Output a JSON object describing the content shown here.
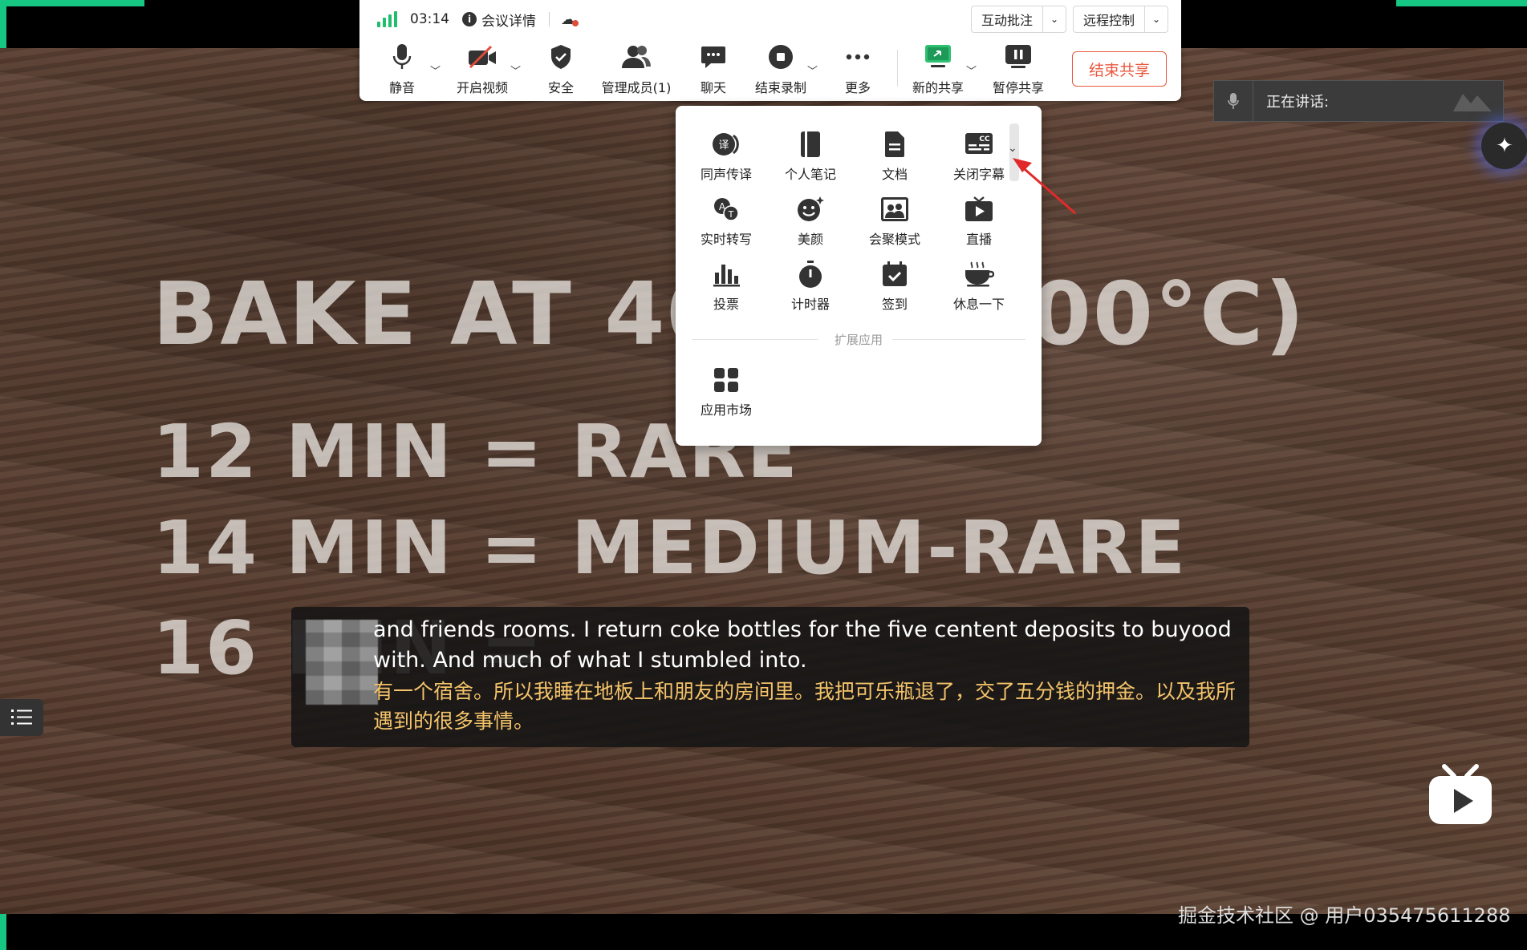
{
  "status_bar": {
    "timer": "03:14",
    "meeting_details": "会议详情",
    "interactive_annotation": "互动批注",
    "remote_control": "远程控制"
  },
  "toolbar": {
    "mute": "静音",
    "start_video": "开启视频",
    "security": "安全",
    "manage_members": "管理成员(1)",
    "chat": "聊天",
    "end_recording": "结束录制",
    "more": "更多",
    "new_share": "新的共享",
    "pause_share": "暂停共享",
    "end_share": "结束共享"
  },
  "more_menu": {
    "items": [
      {
        "label": "同声传译",
        "icon": "interpretation-icon"
      },
      {
        "label": "个人笔记",
        "icon": "notebook-icon"
      },
      {
        "label": "文档",
        "icon": "document-icon"
      },
      {
        "label": "关闭字幕",
        "icon": "captions-icon"
      },
      {
        "label": "实时转写",
        "icon": "transcription-icon"
      },
      {
        "label": "美颜",
        "icon": "beauty-icon"
      },
      {
        "label": "会聚模式",
        "icon": "together-mode-icon"
      },
      {
        "label": "直播",
        "icon": "live-icon"
      },
      {
        "label": "投票",
        "icon": "poll-icon"
      },
      {
        "label": "计时器",
        "icon": "timer-icon"
      },
      {
        "label": "签到",
        "icon": "check-in-icon"
      },
      {
        "label": "休息一下",
        "icon": "coffee-break-icon"
      }
    ],
    "section_label": "扩展应用",
    "app_market": "应用市场"
  },
  "speaking": {
    "label": "正在讲话:"
  },
  "slide": {
    "line1": "BAKE AT 400°F (200°C)",
    "line2": "12 MIN = RARE",
    "line3": "14 MIN = MEDIUM-RARE",
    "line4": "16 MIN ="
  },
  "subtitles": {
    "english": "and friends rooms. I return coke bottles for the five centent deposits to buyood with. And much of what I stumbled into.",
    "chinese": "有一个宿舍。所以我睡在地板上和朋友的房间里。我把可乐瓶退了，交了五分钱的押金。以及我所遇到的很多事情。"
  },
  "watermark": "掘金技术社区 @ 用户035475611288",
  "colors": {
    "accent_green": "#16c784",
    "end_share_red": "#e9573f",
    "subtitle_yellow": "#f4c36a",
    "arrow_red": "#e02a2a"
  }
}
